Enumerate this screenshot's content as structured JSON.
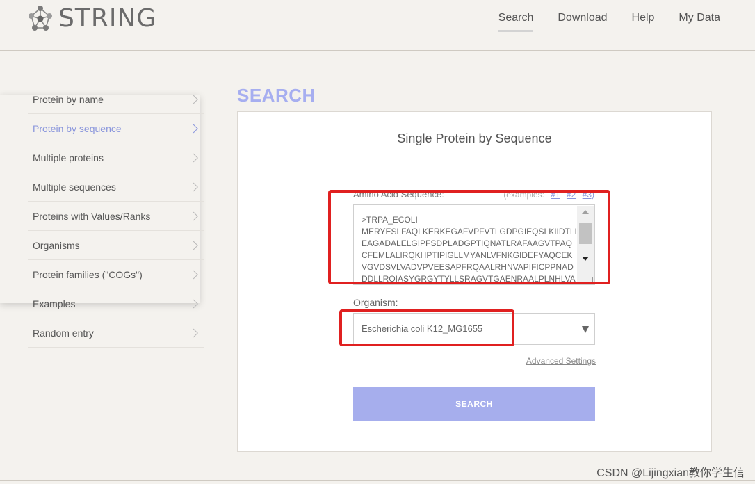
{
  "brand": {
    "name": "STRING",
    "logo_icon": "network-icon"
  },
  "nav": {
    "items": [
      {
        "label": "Search",
        "active": true
      },
      {
        "label": "Download",
        "active": false
      },
      {
        "label": "Help",
        "active": false
      },
      {
        "label": "My Data",
        "active": false
      }
    ]
  },
  "sidebar": {
    "items": [
      {
        "label": "Protein by name",
        "active": false
      },
      {
        "label": "Protein by sequence",
        "active": true
      },
      {
        "label": "Multiple proteins",
        "active": false
      },
      {
        "label": "Multiple sequences",
        "active": false
      },
      {
        "label": "Proteins with Values/Ranks",
        "active": false
      },
      {
        "label": "Organisms",
        "active": false
      },
      {
        "label": "Protein families (\"COGs\")",
        "active": false
      },
      {
        "label": "Examples",
        "active": false
      },
      {
        "label": "Random entry",
        "active": false
      }
    ]
  },
  "main": {
    "title": "SEARCH",
    "panel_title": "Single Protein by Sequence",
    "sequence_label": "Amino Acid Sequence:",
    "examples_label": "(examples:",
    "examples": [
      "#1",
      "#2",
      "#3)"
    ],
    "sequence_value": ">TRPA_ECOLI\nMERYESLFAQLKERKEGAFVPFVTLGDPGIEQSLKIIDTLI\nEAGADALELGIPFSDPLADGPTIQNATLRAFAAGVTPAQ\nCFEMLALIRQKHPTIPIGLLMYANLVFNKGIDEFYAQCEK\nVGVDSVLVADVPVEESAPFRQAALRHNVAPIFICPPNAD\nDDLLRQIASYGRGYTYLLSRAGVTGAENRAALPLNHLVA\nKLKEYNAAPPLQGFGISAPDQVKAAIDAGAAGAISGSA",
    "organism_label": "Organism:",
    "organism_value": "Escherichia coli K12_MG1655",
    "advanced_label": "Advanced Settings",
    "search_button": "SEARCH"
  },
  "watermark": "CSDN @Lijingxian教你学生信",
  "colors": {
    "accent": "#a6aeed",
    "active_link": "#8a96dc",
    "highlight": "#e02020",
    "background": "#f4f2ee"
  }
}
